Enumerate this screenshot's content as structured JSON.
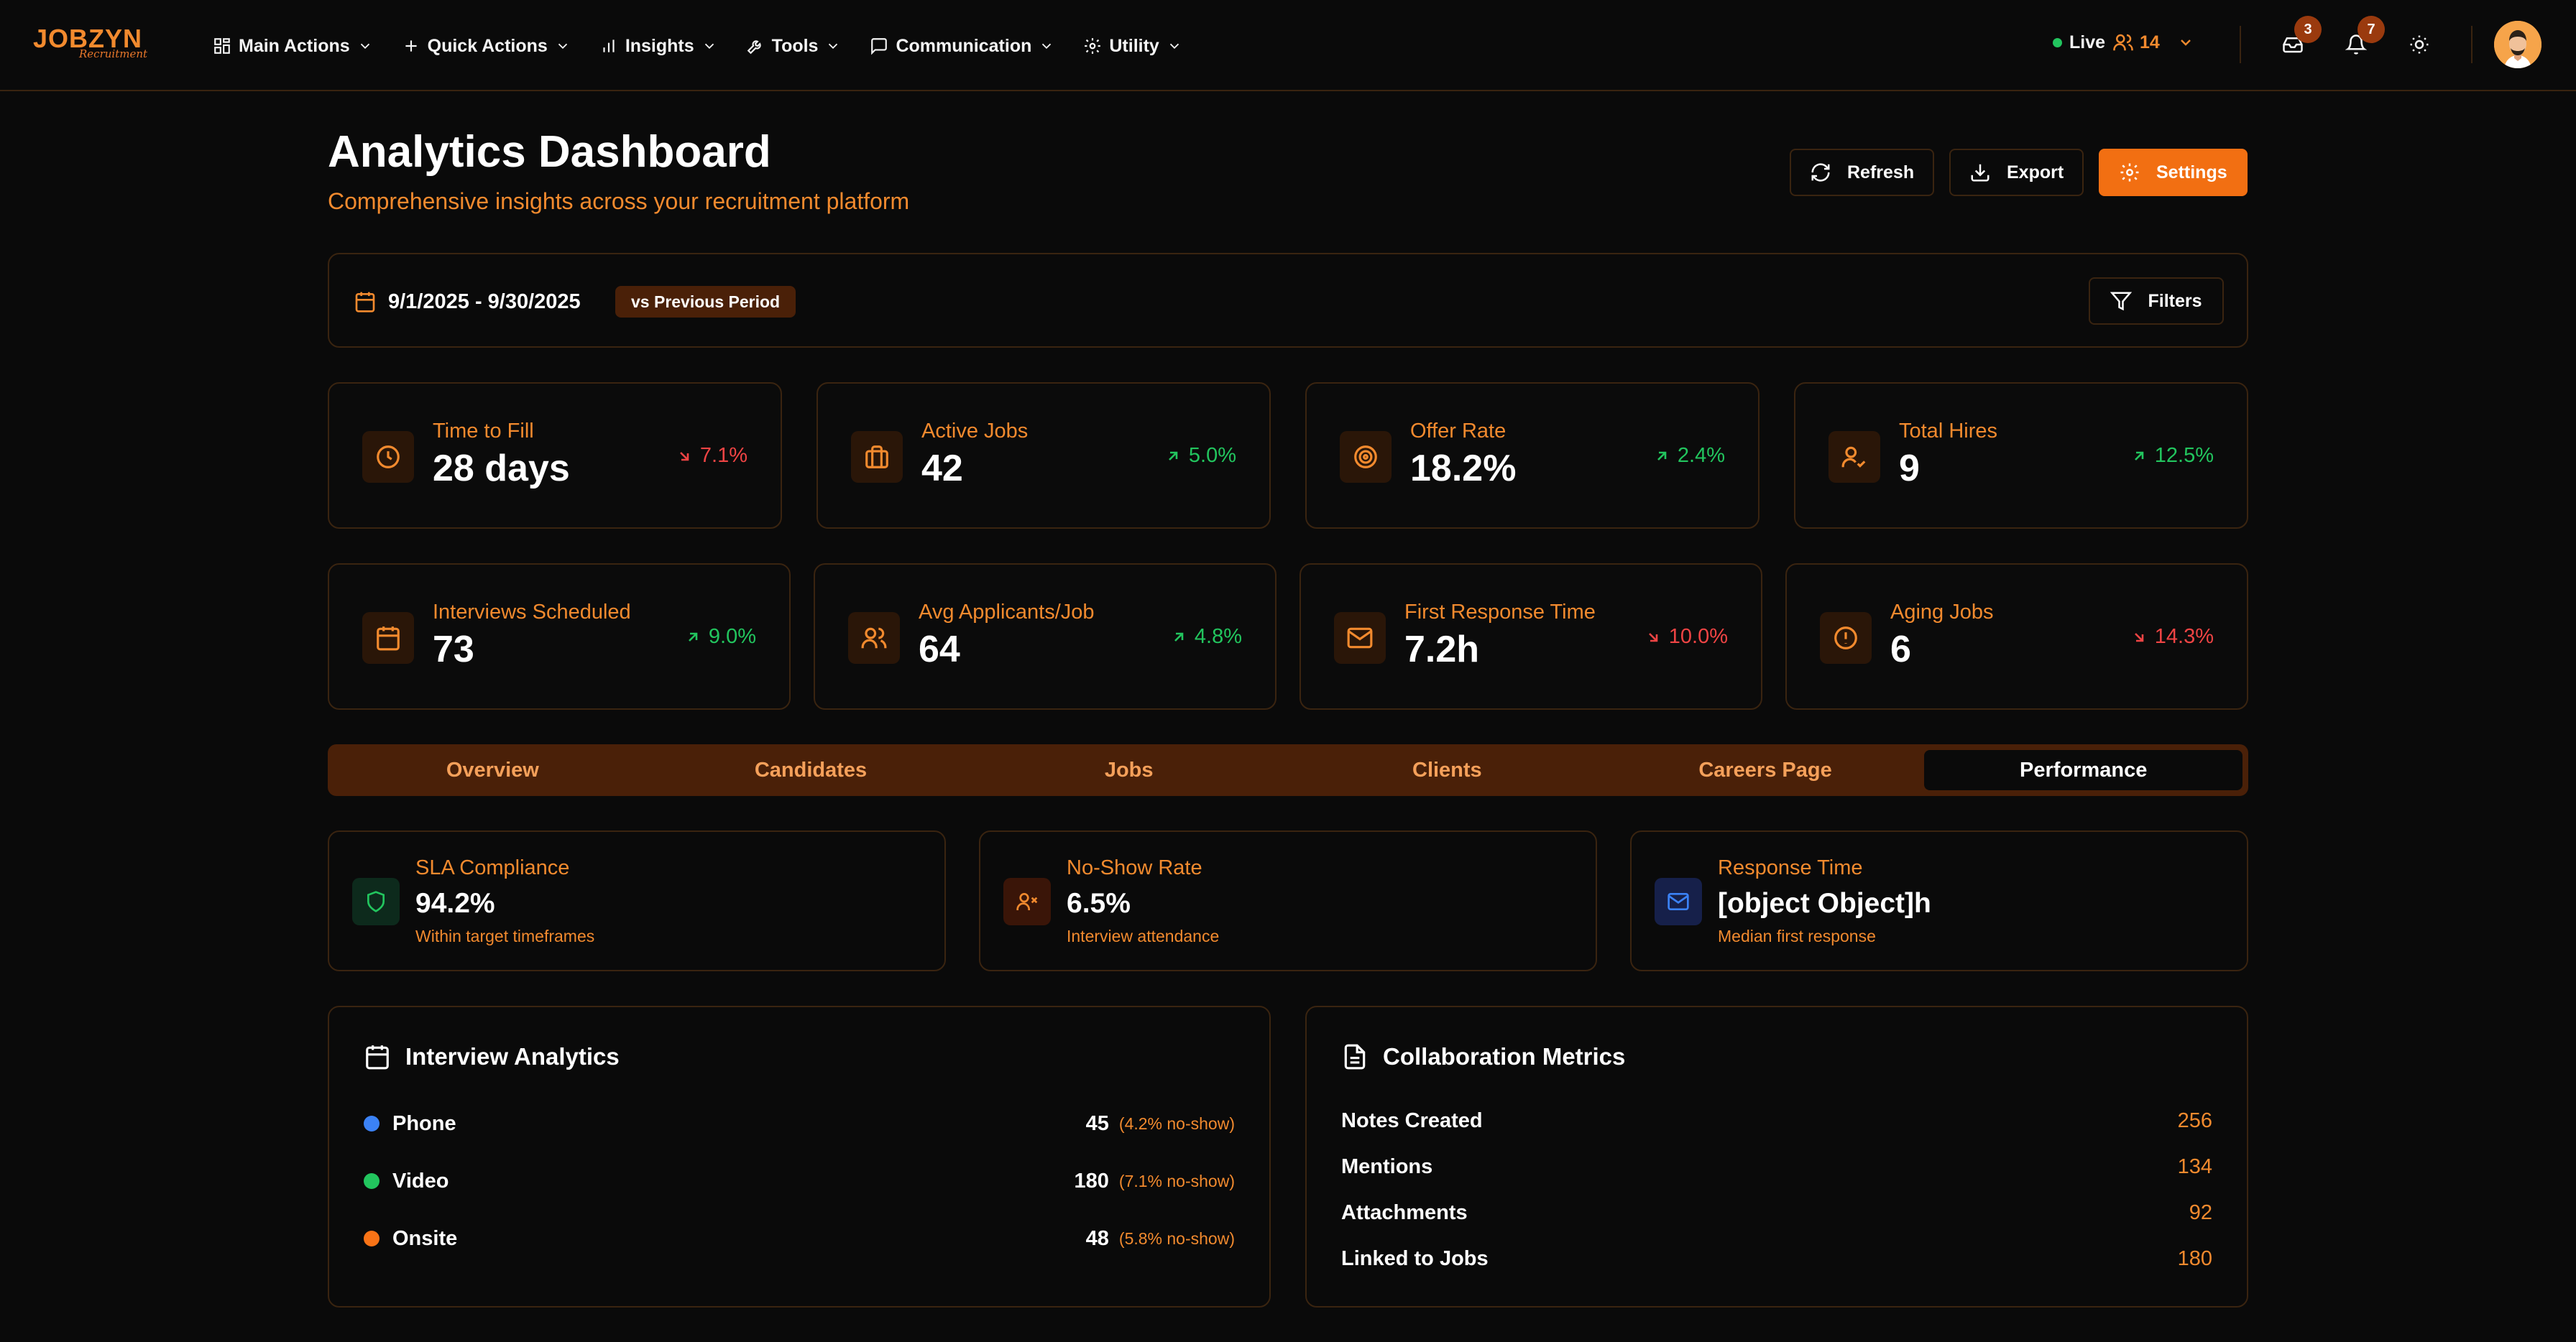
{
  "brand": {
    "name": "JOBZYN",
    "tagline": "Recruitment"
  },
  "nav": [
    {
      "label": "Main Actions",
      "icon": "grid-icon"
    },
    {
      "label": "Quick Actions",
      "icon": "plus-icon"
    },
    {
      "label": "Insights",
      "icon": "bar-chart-icon"
    },
    {
      "label": "Tools",
      "icon": "wrench-icon"
    },
    {
      "label": "Communication",
      "icon": "message-icon"
    },
    {
      "label": "Utility",
      "icon": "gear-icon"
    }
  ],
  "status": {
    "live_label": "Live",
    "online_count": "14"
  },
  "notifications": {
    "inbox_count": "3",
    "bell_count": "7"
  },
  "header": {
    "title": "Analytics Dashboard",
    "subtitle": "Comprehensive insights across your recruitment platform",
    "refresh_label": "Refresh",
    "export_label": "Export",
    "settings_label": "Settings"
  },
  "date_filter": {
    "range": "9/1/2025 - 9/30/2025",
    "compare_label": "vs Previous Period",
    "filters_label": "Filters"
  },
  "kpis_row1": [
    {
      "label": "Time to Fill",
      "value": "28 days",
      "change": "7.1%",
      "direction": "down",
      "icon": "clock-icon"
    },
    {
      "label": "Active Jobs",
      "value": "42",
      "change": "5.0%",
      "direction": "up",
      "icon": "briefcase-icon"
    },
    {
      "label": "Offer Rate",
      "value": "18.2%",
      "change": "2.4%",
      "direction": "up",
      "icon": "target-icon"
    },
    {
      "label": "Total Hires",
      "value": "9",
      "change": "12.5%",
      "direction": "up",
      "icon": "user-check-icon"
    }
  ],
  "kpis_row2": [
    {
      "label": "Interviews Scheduled",
      "value": "73",
      "change": "9.0%",
      "direction": "up",
      "icon": "calendar-icon"
    },
    {
      "label": "Avg Applicants/Job",
      "value": "64",
      "change": "4.8%",
      "direction": "up",
      "icon": "users-icon"
    },
    {
      "label": "First Response Time",
      "value": "7.2h",
      "change": "10.0%",
      "direction": "down",
      "icon": "mail-icon"
    },
    {
      "label": "Aging Jobs",
      "value": "6",
      "change": "14.3%",
      "direction": "down",
      "icon": "alert-circle-icon"
    }
  ],
  "tabs": [
    {
      "label": "Overview"
    },
    {
      "label": "Candidates"
    },
    {
      "label": "Jobs"
    },
    {
      "label": "Clients"
    },
    {
      "label": "Careers Page"
    },
    {
      "label": "Performance",
      "active": true
    }
  ],
  "performance": [
    {
      "label": "SLA Compliance",
      "value": "94.2%",
      "sub": "Within target timeframes",
      "icon": "shield-icon",
      "color": "#22c55e",
      "bg": "#0d2a1c"
    },
    {
      "label": "No-Show Rate",
      "value": "6.5%",
      "sub": "Interview attendance",
      "icon": "user-x-icon",
      "color": "#f28a2e",
      "bg": "#3a1508"
    },
    {
      "label": "Response Time",
      "value": "[object Object]h",
      "sub": "Median first response",
      "icon": "mail-icon",
      "color": "#3b82f6",
      "bg": "#16204a"
    }
  ],
  "interview_analytics": {
    "title": "Interview Analytics",
    "rows": [
      {
        "name": "Phone",
        "value": "45",
        "note": "(4.2% no-show)",
        "color": "#3b82f6"
      },
      {
        "name": "Video",
        "value": "180",
        "note": "(7.1% no-show)",
        "color": "#22c55e"
      },
      {
        "name": "Onsite",
        "value": "48",
        "note": "(5.8% no-show)",
        "color": "#f97316"
      }
    ]
  },
  "collaboration_metrics": {
    "title": "Collaboration Metrics",
    "rows": [
      {
        "name": "Notes Created",
        "value": "256"
      },
      {
        "name": "Mentions",
        "value": "134"
      },
      {
        "name": "Attachments",
        "value": "92"
      },
      {
        "name": "Linked to Jobs",
        "value": "180"
      }
    ]
  }
}
